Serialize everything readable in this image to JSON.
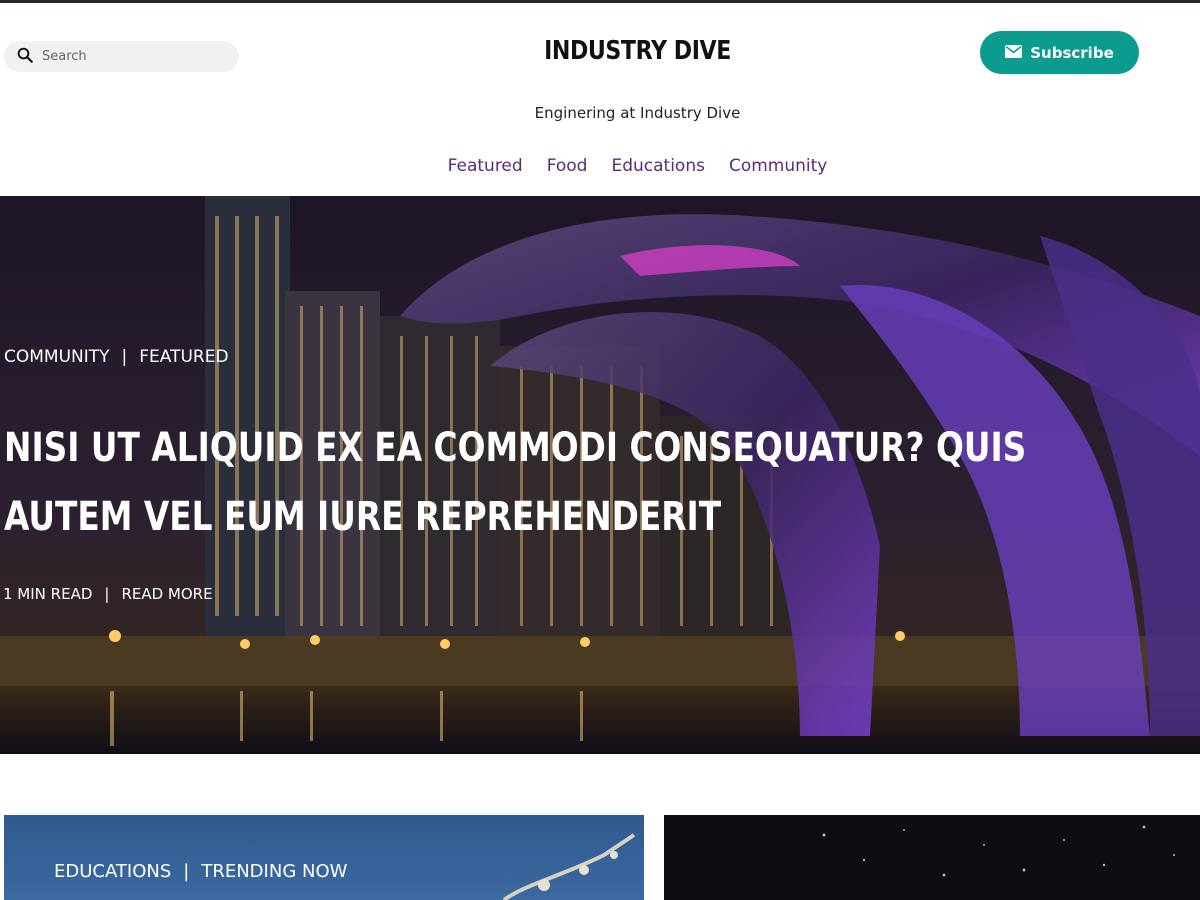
{
  "header": {
    "search_placeholder": "Search",
    "brand": "INDUSTRY DIVE",
    "tagline": "Enginering at Industry Dive",
    "subscribe_label": "Subscribe"
  },
  "nav": {
    "items": [
      "Featured",
      "Food",
      "Educations",
      "Community"
    ]
  },
  "hero": {
    "category_1": "COMMUNITY",
    "category_2": "FEATURED",
    "separator": "|",
    "title": "NISI UT ALIQUID EX EA COMMODI CONSEQUATUR? QUIS AUTEM VEL EUM IURE REPREHENDERIT",
    "read_time": "1 MIN READ",
    "read_more": "READ MORE"
  },
  "cards": [
    {
      "category_1": "EDUCATIONS",
      "category_2": "TRENDING NOW"
    },
    {
      "category_1": "",
      "category_2": ""
    }
  ],
  "colors": {
    "accent": "#0b9b8f",
    "nav_link": "#5b2a7e",
    "topbar": "#23282d"
  }
}
